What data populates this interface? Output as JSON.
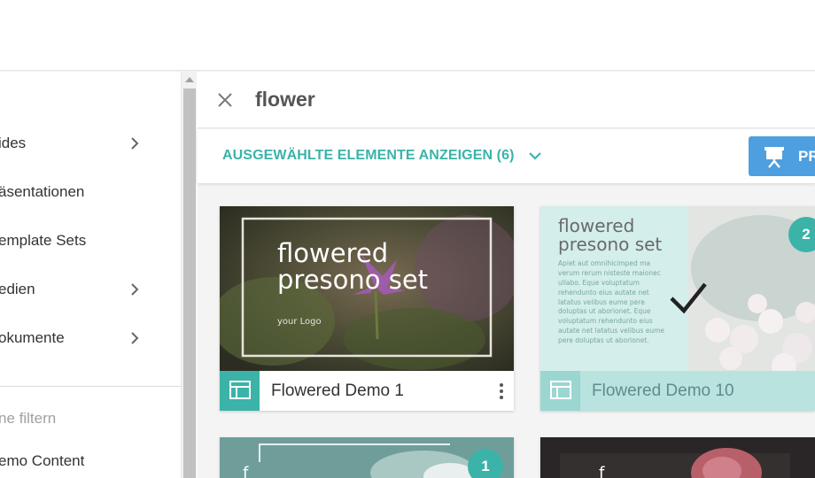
{
  "sidebar": {
    "items": [
      {
        "label": "ides",
        "has_children": true
      },
      {
        "label": "äsentationen",
        "has_children": false
      },
      {
        "label": "emplate Sets",
        "has_children": false
      },
      {
        "label": "edien",
        "has_children": true
      },
      {
        "label": "okumente",
        "has_children": true
      }
    ],
    "filter_heading": "ne filtern",
    "filter_item": "emo Content"
  },
  "search": {
    "query": "flower"
  },
  "selection": {
    "link_label": "AUSGEWÄHLTE ELEMENTE ANZEIGEN (6)",
    "present_label": "PR"
  },
  "cards": [
    {
      "name": "Flowered Demo 1",
      "thumb_title": "flowered presono set",
      "thumb_logo": "your Logo",
      "selected": false
    },
    {
      "name": "Flowered Demo 10",
      "thumb_title": "flowered presono set",
      "thumb_body": "Apiet aut omnihicimped ma verum rerum nisteste maionec ullabo. Eque voluptatum rehendunto eius autate net latatus velibus eume pere doluptas ut aborionet. Eque voluptatum rehendunto eius autate net latatus velibus eume pere doluptas ut aborionet.",
      "badge": "2",
      "selected": true
    },
    {
      "name": "",
      "badge": "1",
      "selected": false
    },
    {
      "name": "",
      "selected": false
    }
  ],
  "colors": {
    "accent": "#3bb3a9",
    "button": "#4d9fdf",
    "selected_footer": "#b9e3df"
  }
}
